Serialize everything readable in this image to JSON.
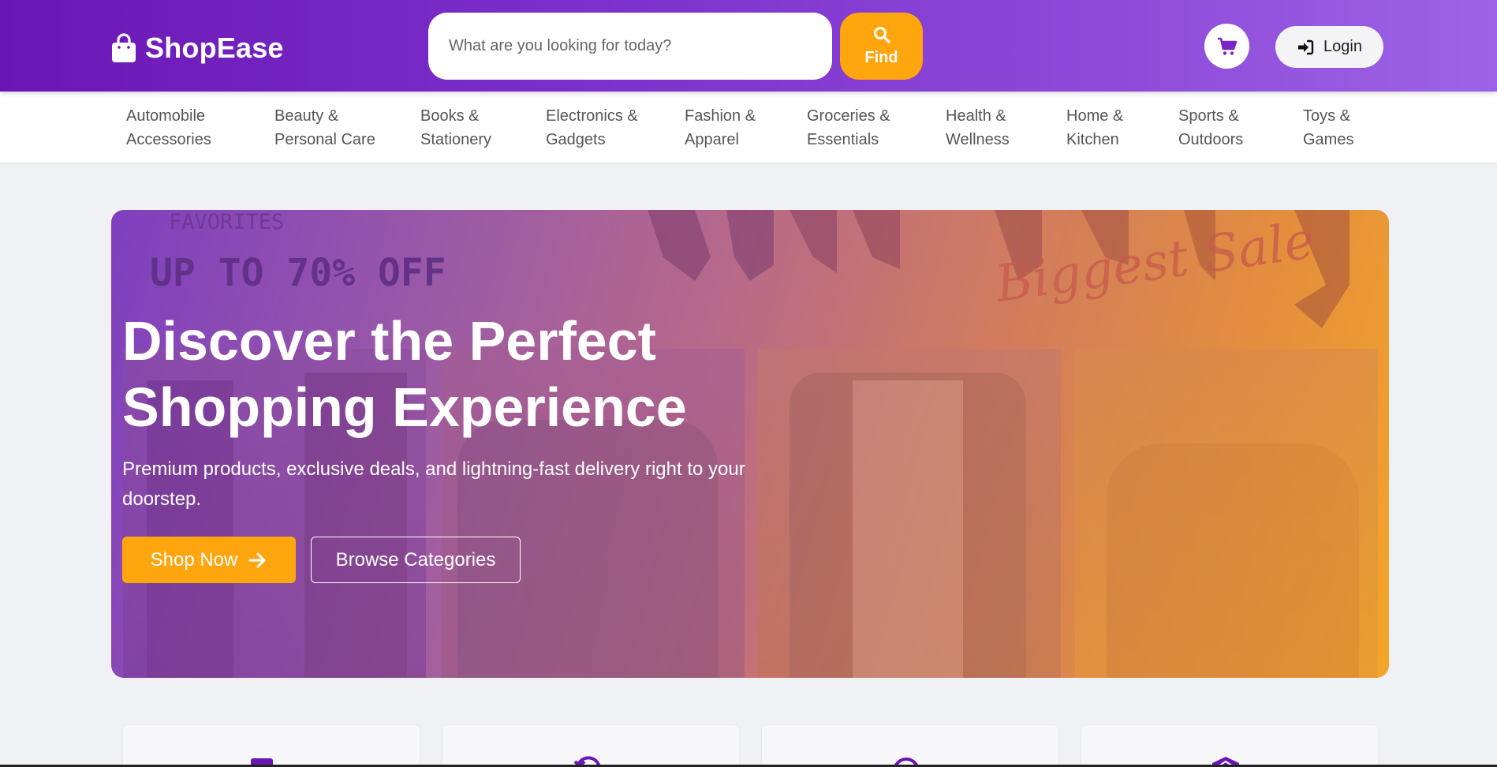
{
  "brand": {
    "name": "ShopEase",
    "logo_icon": "shopping-bag-icon"
  },
  "search": {
    "placeholder": "What are you looking for today?",
    "value": "",
    "button_label": "Find",
    "button_icon": "search-icon"
  },
  "header_actions": {
    "cart_icon": "cart-icon",
    "login_label": "Login",
    "login_icon": "sign-in-icon"
  },
  "categories": [
    {
      "line1": "Automobile",
      "line2": "Accessories"
    },
    {
      "line1": "Beauty &",
      "line2": "Personal Care"
    },
    {
      "line1": "Books &",
      "line2": "Stationery"
    },
    {
      "line1": "Electronics &",
      "line2": "Gadgets"
    },
    {
      "line1": "Fashion &",
      "line2": "Apparel"
    },
    {
      "line1": "Groceries &",
      "line2": "Essentials"
    },
    {
      "line1": "Health &",
      "line2": "Wellness"
    },
    {
      "line1": "Home &",
      "line2": "Kitchen"
    },
    {
      "line1": "Sports &",
      "line2": "Outdoors"
    },
    {
      "line1": "Toys &",
      "line2": "Games"
    }
  ],
  "hero": {
    "image_text": {
      "favorites": "FAVORITES",
      "promo": "UP TO 70% OFF",
      "script": "Biggest Sale"
    },
    "title_line1": "Discover the Perfect",
    "title_line2": "Shopping Experience",
    "subtitle": "Premium products, exclusive deals, and lightning-fast delivery right to your doorstep.",
    "primary_button": "Shop Now",
    "primary_icon": "arrow-right-icon",
    "secondary_button": "Browse Categories"
  },
  "feature_cards": [
    {
      "icon": "truck-icon"
    },
    {
      "icon": "return-icon"
    },
    {
      "icon": "clock-icon"
    },
    {
      "icon": "shield-icon"
    }
  ],
  "colors": {
    "brand_purple": "#6a16b5",
    "accent_orange": "#ffa50e",
    "page_bg": "#f0f1f5"
  }
}
